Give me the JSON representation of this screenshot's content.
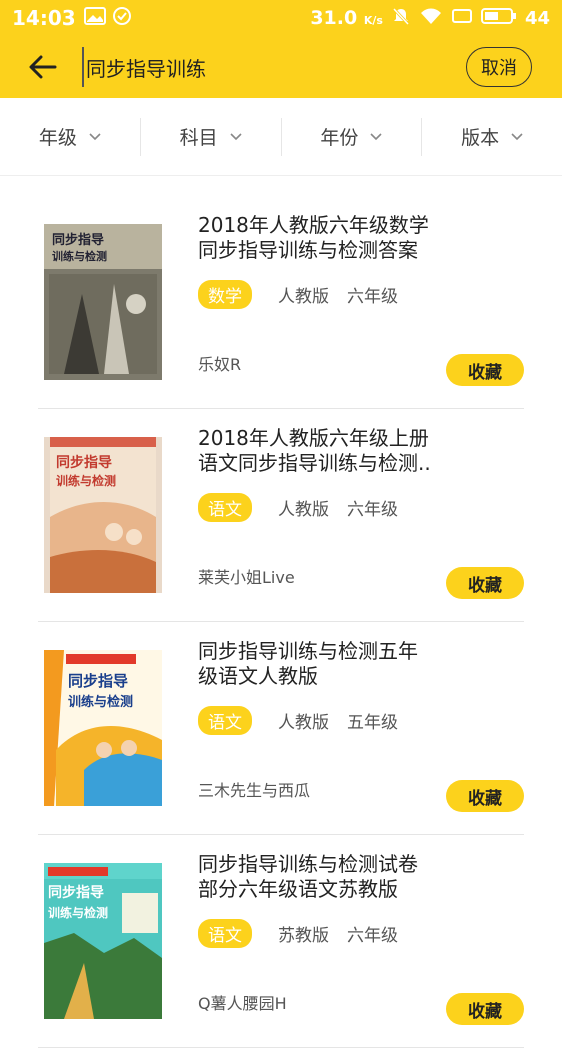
{
  "status_bar": {
    "time": "14:03",
    "speed": "31.0",
    "speed_unit": "K/s",
    "battery": "44"
  },
  "header": {
    "search_value": "同步指导训练",
    "cancel_label": "取消"
  },
  "filters": [
    {
      "label": "年级"
    },
    {
      "label": "科目"
    },
    {
      "label": "年份"
    },
    {
      "label": "版本"
    }
  ],
  "results": [
    {
      "title": "2018年人教版六年级数学\n同步指导训练与检测答案",
      "subject": "数学",
      "edition": "人教版",
      "grade": "六年级",
      "author": "乐奴R",
      "collect_label": "收藏",
      "cover_text": "同步指导训练与检测"
    },
    {
      "title": "2018年人教版六年级上册\n语文同步指导训练与检测..",
      "subject": "语文",
      "edition": "人教版",
      "grade": "六年级",
      "author": "莱芙小姐Live",
      "collect_label": "收藏",
      "cover_text": "同步指导训练与检测"
    },
    {
      "title": "同步指导训练与检测五年\n级语文人教版",
      "subject": "语文",
      "edition": "人教版",
      "grade": "五年级",
      "author": "三木先生与西瓜",
      "collect_label": "收藏",
      "cover_text": "同步指导训练与检测"
    },
    {
      "title": "同步指导训练与检测试卷\n部分六年级语文苏教版",
      "subject": "语文",
      "edition": "苏教版",
      "grade": "六年级",
      "author": "Q薯人腰园H",
      "collect_label": "收藏",
      "cover_text": "同步指导训练与检测"
    }
  ],
  "colors": {
    "accent": "#fcd21c"
  }
}
